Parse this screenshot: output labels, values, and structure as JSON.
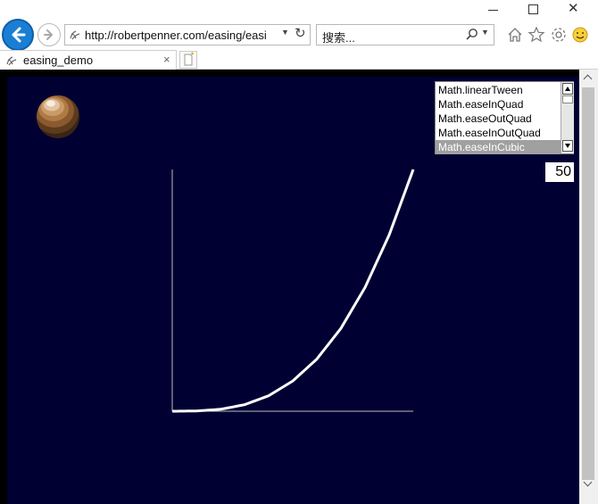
{
  "window": {
    "min_icon": "minimize-icon",
    "max_icon": "maximize-icon",
    "close_glyph": "✕"
  },
  "toolbar": {
    "url": "http://robertpenner.com/easing/easi",
    "search_placeholder": "搜索...",
    "icons": [
      "back-arrow-icon",
      "forward-arrow-icon",
      "search-icon",
      "home-icon",
      "favorites-star-icon",
      "settings-gear-icon",
      "feedback-smiley-icon"
    ]
  },
  "tab": {
    "title": "easing_demo",
    "close_glyph": "×"
  },
  "demo": {
    "listbox_items": [
      "Math.linearTween",
      "Math.easeInQuad",
      "Math.easeOutQuad",
      "Math.easeInOutQuad",
      "Math.easeInCubic"
    ],
    "selected_index": 4,
    "duration_value": "50",
    "colors": {
      "stage_bg": "#000033",
      "curve": "#ffffff",
      "selection": "#a0a0a0"
    }
  },
  "chart_data": {
    "type": "line",
    "title": "",
    "xlabel": "",
    "ylabel": "",
    "xlim": [
      0,
      1
    ],
    "ylim": [
      0,
      1
    ],
    "grid": false,
    "series": [
      {
        "x": [
          0,
          0.1,
          0.2,
          0.3,
          0.4,
          0.5,
          0.6,
          0.7,
          0.8,
          0.9,
          1.0
        ],
        "y": [
          0,
          0.001,
          0.008,
          0.027,
          0.064,
          0.125,
          0.216,
          0.343,
          0.512,
          0.729,
          1.0
        ]
      }
    ]
  }
}
